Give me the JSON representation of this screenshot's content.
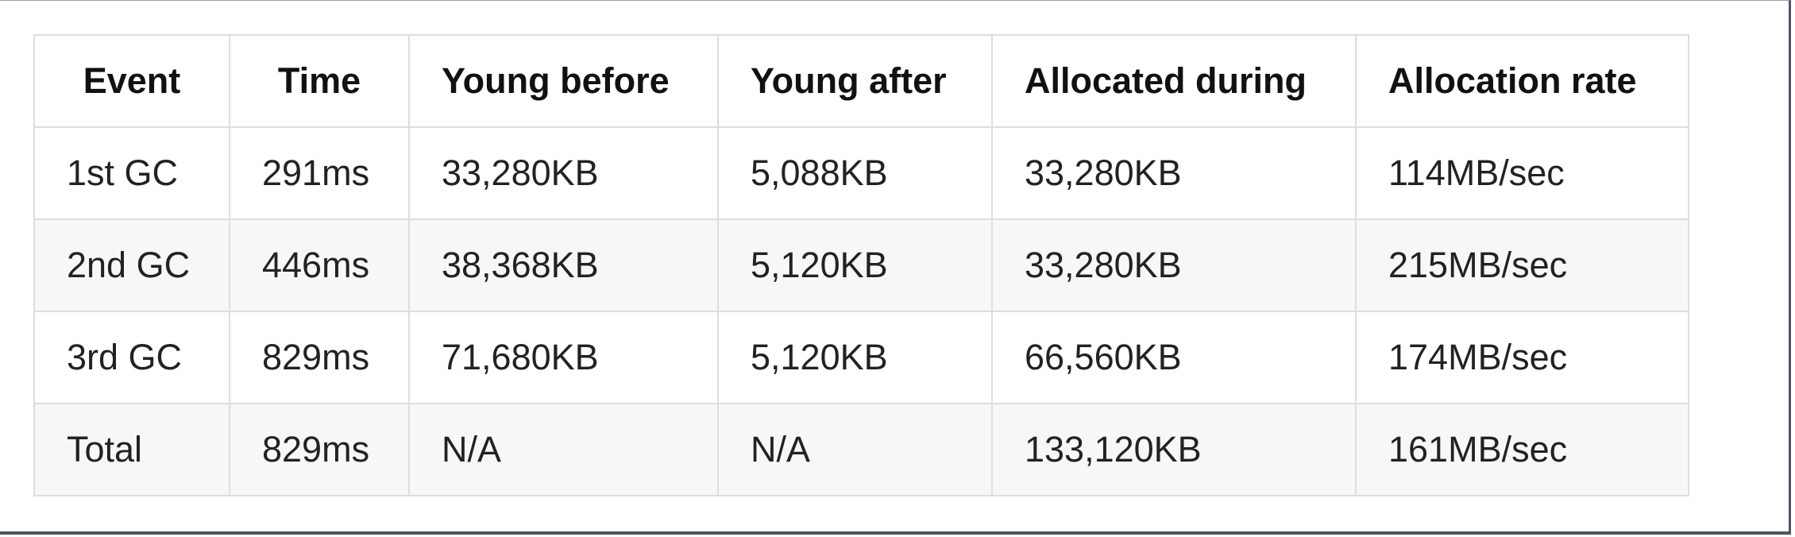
{
  "table": {
    "headers": [
      "Event",
      "Time",
      "Young before",
      "Young after",
      "Allocated during",
      "Allocation rate"
    ],
    "rows": [
      [
        "1st GC",
        "291ms",
        "33,280KB",
        "5,088KB",
        "33,280KB",
        "114MB/sec"
      ],
      [
        "2nd GC",
        "446ms",
        "38,368KB",
        "5,120KB",
        "33,280KB",
        "215MB/sec"
      ],
      [
        "3rd GC",
        "829ms",
        "71,680KB",
        "5,120KB",
        "66,560KB",
        "174MB/sec"
      ],
      [
        "Total",
        "829ms",
        "N/A",
        "N/A",
        "133,120KB",
        "161MB/sec"
      ]
    ]
  },
  "colors": {
    "border": "#dddddd",
    "stripe": "#f7f7f7",
    "frame": "#4b5563"
  }
}
